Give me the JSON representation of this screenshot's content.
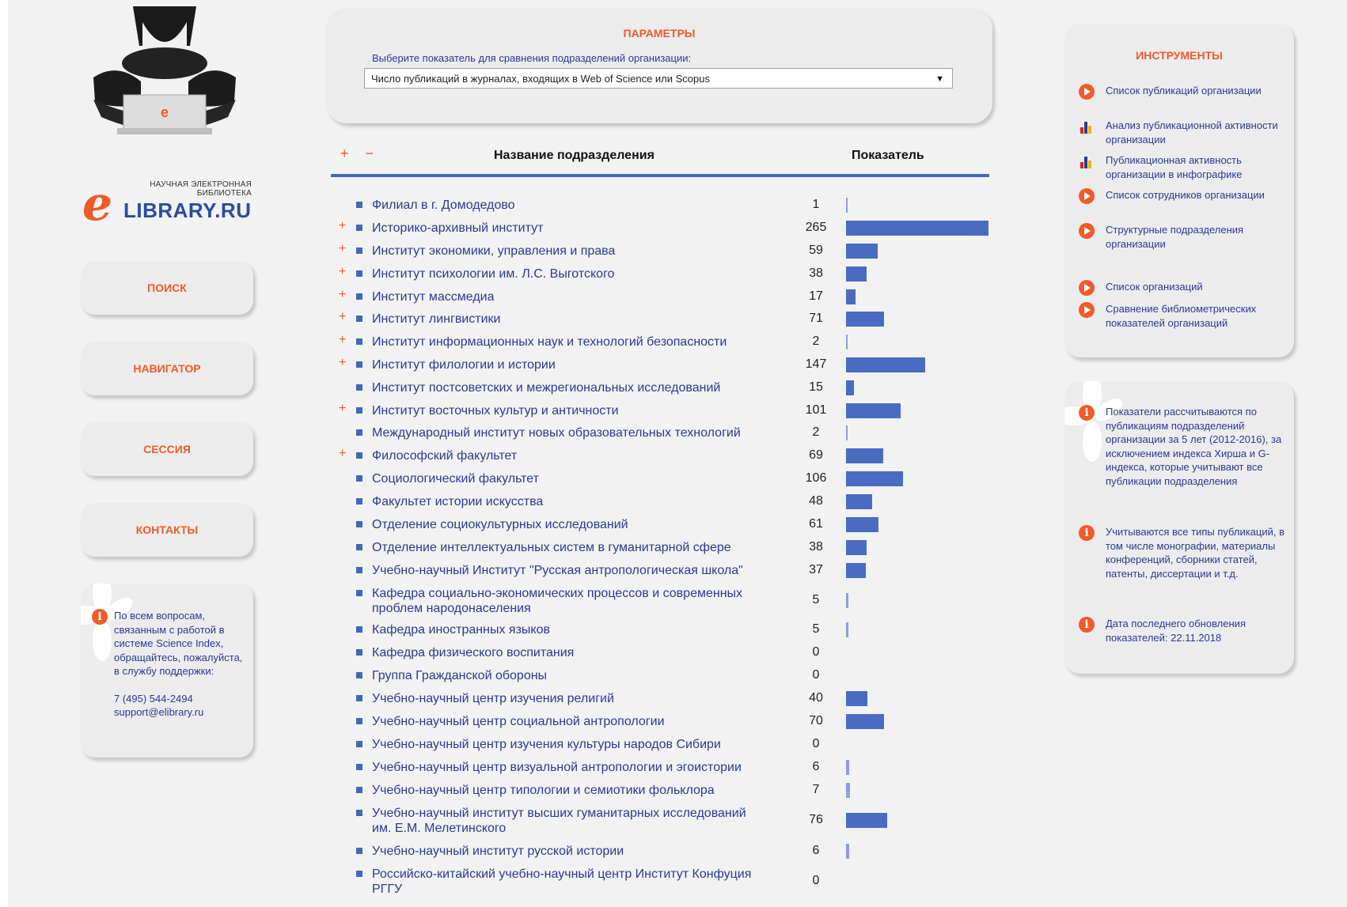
{
  "logo": {
    "subtitle_line1": "НАУЧНАЯ ЭЛЕКТРОННАЯ",
    "subtitle_line2": "БИБЛИОТЕКА",
    "letter": "e",
    "name": "LIBRARY.RU"
  },
  "nav": {
    "search": "ПОИСК",
    "navigator": "НАВИГАТОР",
    "session": "СЕССИЯ",
    "contacts": "КОНТАКТЫ"
  },
  "support": {
    "text": "По всем вопросам, связанным с работой в системе Science Index, обращайтесь, пожалуйста, в службу поддержки:",
    "phone": "7 (495) 544-2494",
    "email": "support@elibrary.ru"
  },
  "params": {
    "title": "ПАРАМЕТРЫ",
    "label": "Выберите показатель для сравнения подразделений организации:",
    "selected": "Число публикаций в журналах, входящих в Web of Science или Scopus",
    "arrow": "▼"
  },
  "table": {
    "expand_collapse": "+ −",
    "col_name": "Название подразделения",
    "col_value": "Показатель",
    "max_value": 265,
    "rows": [
      {
        "expand": "",
        "name": "Филиал в г. Домодедово",
        "value": 1,
        "display": "1"
      },
      {
        "expand": "+",
        "name": "Историко-архивный институт",
        "value": 265,
        "display": "265"
      },
      {
        "expand": "+",
        "name": "Институт экономики, управления и права",
        "value": 59,
        "display": "59"
      },
      {
        "expand": "+",
        "name": "Институт психологии им. Л.С. Выготского",
        "value": 38,
        "display": "38"
      },
      {
        "expand": "+",
        "name": "Институт массмедиа",
        "value": 17,
        "display": "17"
      },
      {
        "expand": "+",
        "name": "Институт лингвистики",
        "value": 71,
        "display": "71"
      },
      {
        "expand": "+",
        "name": "Институт информационных наук и технологий безопасности",
        "value": 2,
        "display": "2"
      },
      {
        "expand": "+",
        "name": "Институт филологии и истории",
        "value": 147,
        "display": "147"
      },
      {
        "expand": "",
        "name": "Институт постсоветских и межрегиональных исследований",
        "value": 15,
        "display": "15"
      },
      {
        "expand": "+",
        "name": "Институт восточных культур и античности",
        "value": 101,
        "display": "101"
      },
      {
        "expand": "",
        "name": "Международный институт новых образовательных технологий",
        "value": 2,
        "display": "2"
      },
      {
        "expand": "+",
        "name": "Философский факультет",
        "value": 69,
        "display": "69"
      },
      {
        "expand": "",
        "name": "Социологический факультет",
        "value": 106,
        "display": "106"
      },
      {
        "expand": "",
        "name": "Факультет истории искусства",
        "value": 48,
        "display": "48"
      },
      {
        "expand": "",
        "name": "Отделение социокультурных исследований",
        "value": 61,
        "display": "61"
      },
      {
        "expand": "",
        "name": "Отделение интеллектуальных систем в гуманитарной сфере",
        "value": 38,
        "display": "38"
      },
      {
        "expand": "",
        "name": "Учебно-научный Институт \"Русская антропологическая школа\"",
        "value": 37,
        "display": "37"
      },
      {
        "expand": "",
        "name": "Кафедра социально-экономических процессов и современных проблем народонаселения",
        "value": 5,
        "display": "5"
      },
      {
        "expand": "",
        "name": "Кафедра иностранных языков",
        "value": 5,
        "display": "5"
      },
      {
        "expand": "",
        "name": "Кафедра физического воспитания",
        "value": 0,
        "display": "0"
      },
      {
        "expand": "",
        "name": "Группа Гражданской обороны",
        "value": 0,
        "display": "0"
      },
      {
        "expand": "",
        "name": "Учебно-научный центр изучения религий",
        "value": 40,
        "display": "40"
      },
      {
        "expand": "",
        "name": "Учебно-научный центр социальной антропологии",
        "value": 70,
        "display": "70"
      },
      {
        "expand": "",
        "name": "Учебно-научный центр изучения культуры народов Сибири",
        "value": 0,
        "display": "0"
      },
      {
        "expand": "",
        "name": "Учебно-научный центр визуальной антропологии и эгоистории",
        "value": 6,
        "display": "6"
      },
      {
        "expand": "",
        "name": "Учебно-научный центр типологии и семиотики фольклора",
        "value": 7,
        "display": "7"
      },
      {
        "expand": "",
        "name": "Учебно-научный институт высших гуманитарных исследований им. Е.М. Мелетинского",
        "value": 76,
        "display": "76"
      },
      {
        "expand": "",
        "name": "Учебно-научный институт русской истории",
        "value": 6,
        "display": "6"
      },
      {
        "expand": "",
        "name": "Российско-китайский учебно-научный центр Институт Конфуция РГГУ",
        "value": 0,
        "display": "0"
      }
    ]
  },
  "tools": {
    "title": "ИНСТРУМЕНТЫ",
    "items": [
      {
        "icon": "play-icon",
        "label": "Список публикаций организации"
      },
      {
        "icon": "bar-chart-icon",
        "label": "Анализ публикационной активности организации"
      },
      {
        "icon": "bar-chart-icon",
        "label": "Публикационная активность организации в инфографике"
      },
      {
        "icon": "play-icon",
        "label": "Список сотрудников организации"
      },
      {
        "icon": "play-icon",
        "label": "Структурные подразделения организации"
      },
      {
        "icon": "play-icon",
        "label": "Список организаций"
      },
      {
        "icon": "play-icon",
        "label": "Сравнение библиометрических показателей организаций"
      }
    ]
  },
  "notes": [
    "Показатели рассчитываются по публикациям подразделений организации за 5 лет (2012-2016), за исключением индекса Хирша и G-индекса, которые учитывают все публикации подразделения",
    "Учитываются все типы публикаций, в том числе монографии, материалы конференций, сборники статей, патенты, диссертации и т.д.",
    "Дата последнего обновления показателей: 22.11.2018"
  ],
  "colors": {
    "accent": "#f15a29",
    "link": "#2b3a8f",
    "bar": "#4a6bc2",
    "panel": "#ececec"
  }
}
